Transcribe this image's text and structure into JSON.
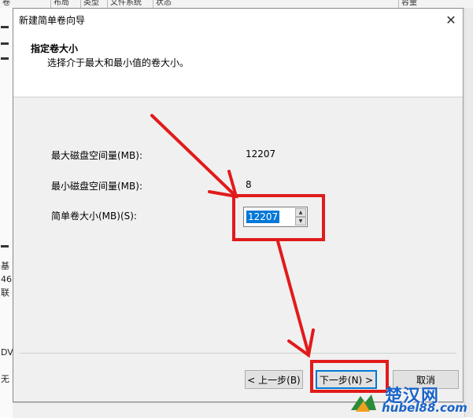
{
  "background": {
    "columns": [
      "卷",
      "布局",
      "类型",
      "文件系统",
      "状态",
      "容量"
    ],
    "left_fragments": [
      "基",
      "46",
      "联",
      "DV",
      "无"
    ]
  },
  "dialog": {
    "title": "新建简单卷向导",
    "close_icon": "close-icon",
    "header_title": "指定卷大小",
    "header_subtitle": "选择介于最大和最小值的卷大小。",
    "max_label": "最大磁盘空间量(MB):",
    "max_value": "12207",
    "min_label": "最小磁盘空间量(MB):",
    "min_value": "8",
    "size_label": "简单卷大小(MB)(S):",
    "size_value": "12207",
    "back_button": "< 上一步(B)",
    "next_button": "下一步(N) >",
    "cancel_button": "取消"
  },
  "annotations": {
    "color": "#e11b1b"
  },
  "watermark": {
    "text": "楚汉网",
    "url": "hubel88.com"
  }
}
